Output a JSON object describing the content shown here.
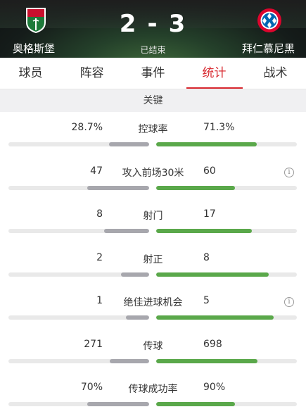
{
  "match": {
    "home_team": "奥格斯堡",
    "away_team": "拜仁慕尼黑",
    "home_score": "2",
    "separator": "-",
    "away_score": "3",
    "status": "已结束"
  },
  "tabs": [
    {
      "label": "球员",
      "active": false
    },
    {
      "label": "阵容",
      "active": false
    },
    {
      "label": "事件",
      "active": false
    },
    {
      "label": "统计",
      "active": true
    },
    {
      "label": "战术",
      "active": false
    }
  ],
  "section_title": "关键",
  "stats": [
    {
      "label": "控球率",
      "home": "28.7%",
      "away": "71.3%",
      "home_share": 0.287,
      "away_share": 0.713,
      "info": false
    },
    {
      "label": "攻入前场30米",
      "home": "47",
      "away": "60",
      "home_share": 0.44,
      "away_share": 0.56,
      "info": true
    },
    {
      "label": "射门",
      "home": "8",
      "away": "17",
      "home_share": 0.32,
      "away_share": 0.68,
      "info": false
    },
    {
      "label": "射正",
      "home": "2",
      "away": "8",
      "home_share": 0.2,
      "away_share": 0.8,
      "info": false
    },
    {
      "label": "绝佳进球机会",
      "home": "1",
      "away": "5",
      "home_share": 0.167,
      "away_share": 0.833,
      "info": true
    },
    {
      "label": "传球",
      "home": "271",
      "away": "698",
      "home_share": 0.28,
      "away_share": 0.72,
      "info": false
    },
    {
      "label": "传球成功率",
      "home": "70%",
      "away": "90%",
      "home_share": 0.44,
      "away_share": 0.56,
      "info": false
    }
  ],
  "info_icon": "info-circle-icon",
  "colors": {
    "accent": "#d8282f",
    "home_bar": "#a7a7ad",
    "away_bar": "#5aa84a",
    "bar_track": "#e9e9e9"
  }
}
